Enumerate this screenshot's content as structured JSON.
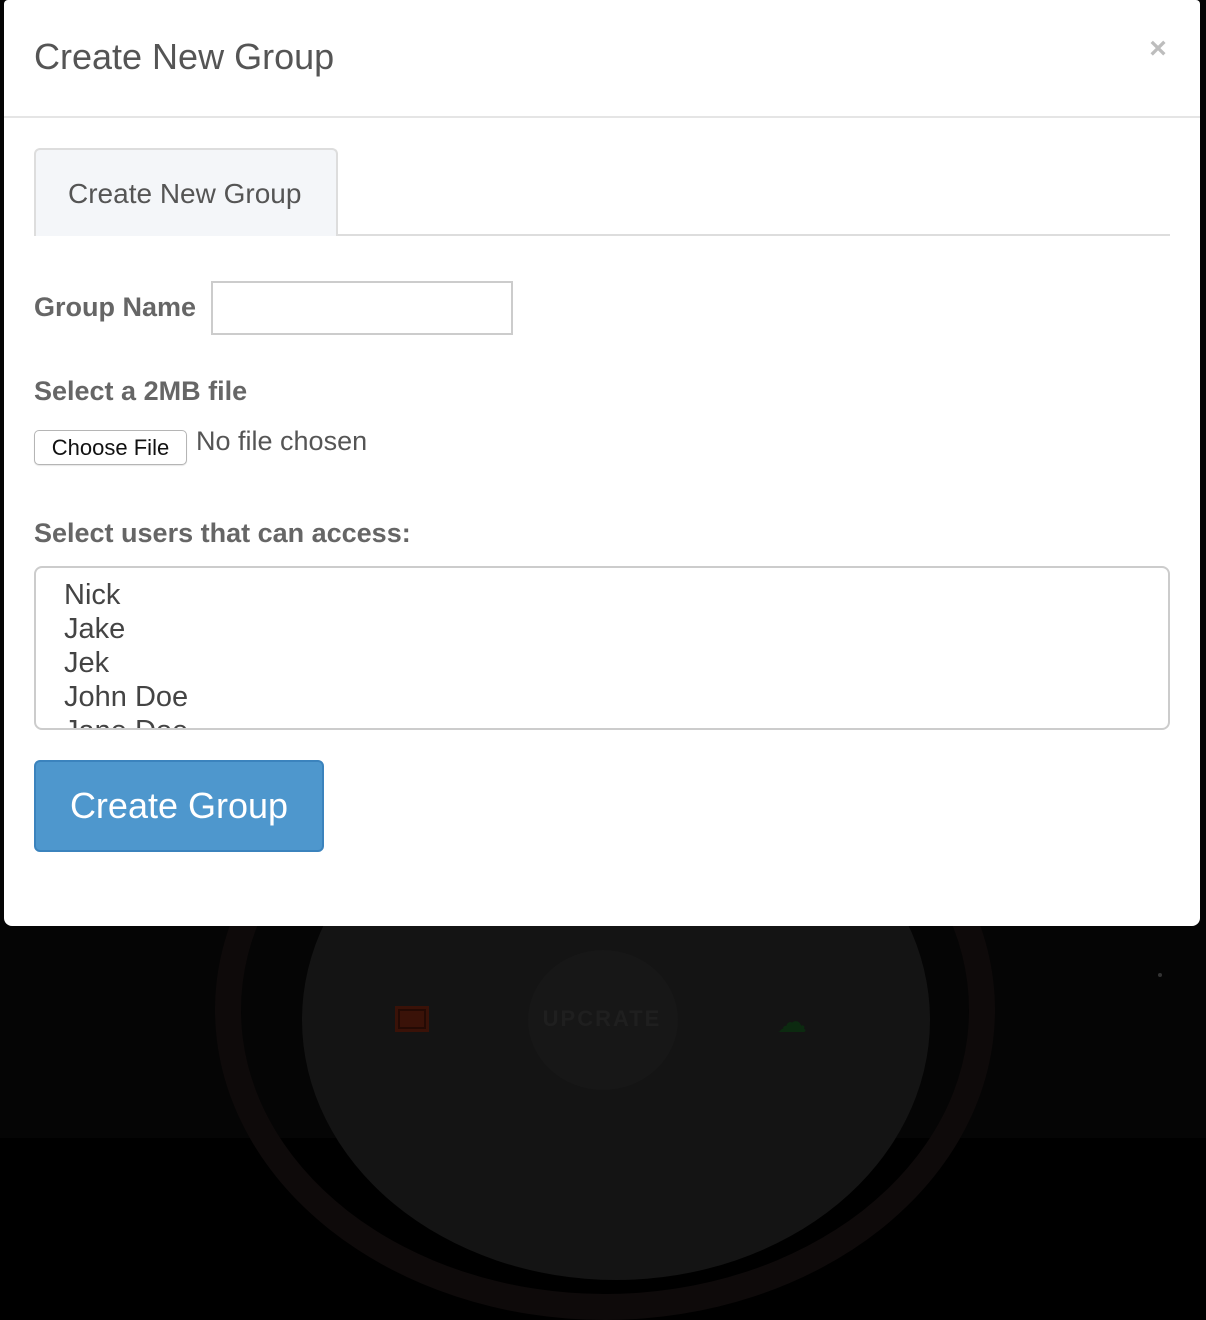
{
  "background": {
    "logo_text": "UPCRATE",
    "icons": [
      "mail-icon",
      "cloud-upload-icon"
    ]
  },
  "modal": {
    "title": "Create New Group",
    "close_symbol": "×",
    "tab_label": "Create New Group",
    "group_name_label": "Group Name",
    "group_name_value": "",
    "file_label": "Select a 2MB file",
    "choose_file_label": "Choose File",
    "file_status": "No file chosen",
    "users_label": "Select users that can access:",
    "users": [
      "Nick",
      "Jake",
      "Jek",
      "John Doe",
      "Jane Doe"
    ],
    "submit_label": "Create Group"
  },
  "colors": {
    "primary_button": "#4e97cd",
    "text": "#555555"
  }
}
